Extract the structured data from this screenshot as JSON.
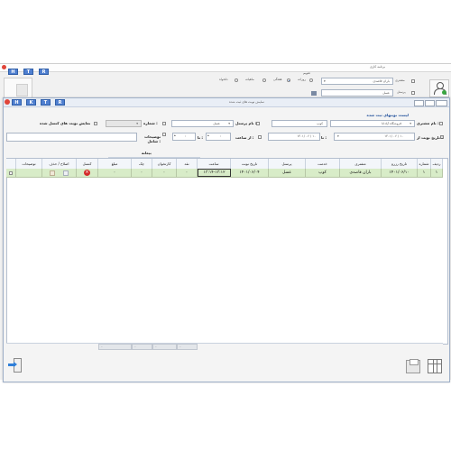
{
  "bg_window": {
    "title": "برنامه کاری",
    "nav_buttons": [
      "H",
      "T",
      "R"
    ],
    "customer_label": "مشتری",
    "customer_value": "باران قاصدی",
    "personnel_label": "پرسنل",
    "personnel_value": "عسل",
    "calendar_label": "تقویم",
    "view_options": [
      {
        "label": "روزانه",
        "selected": false
      },
      {
        "label": "هفتگی",
        "selected": true
      },
      {
        "label": "ماهیانه",
        "selected": false
      },
      {
        "label": "دلخواه",
        "selected": false
      }
    ]
  },
  "dialog": {
    "title": "نمایش نوبت های ثبت شده",
    "nav_buttons": [
      "H",
      "K",
      "T",
      "R"
    ],
    "section_title": "لیست نوبتهای ثبت شده",
    "filters": {
      "customer_label": "نام مشتری :",
      "customer_value": "فروشگاه آپادانا",
      "service_label": "نوع خدمت :",
      "service_value": "کوپ",
      "personnel_label": "نام پرسنل :",
      "personnel_value": "عسل",
      "number_label": "شماره :",
      "show_cancelled_label": "نمایش نوبت های کنسل شده",
      "date_from_label": "تاریخ نوبت از :",
      "date_from_value": "۱۴۰۱/ ۰۶ / ۱۰",
      "date_to_label": "تا :",
      "date_to_value": "۱۴۰۱/ ۰۶ / ۱۰",
      "time_from_label": "از ساعت :",
      "time_from_value": ": ",
      "time_to_label": "تا :",
      "time_to_value": ": ",
      "notes_label": "توضیحات شامل :"
    },
    "table": {
      "group_header": "بیعانه",
      "columns": [
        "ردیف",
        "شماره",
        "تاریخ رزرو",
        "مشتری",
        "خدمت",
        "پرسنل",
        "تاریخ نوبت",
        "ساعت",
        "نقد",
        "کارتخوان",
        "چک",
        "مبلغ",
        "کنسل",
        "اصلاح / حذف",
        "توضیحات"
      ],
      "rows": [
        {
          "row": "۱",
          "number": "۱",
          "reserve_date": "۱۴۰۱/۰۶/۱۰",
          "customer": "باران قاصدی",
          "service": "کوپ",
          "personnel": "عسل",
          "appt_date": "۱۴۰۱/۰۶/۰۴",
          "time": "۱۳:۱۴-۱۳:۱۲",
          "cash": "۰",
          "card": "۰",
          "cheque": "۰",
          "amount": "۰"
        }
      ],
      "footer_totals": [
        "۰",
        "۰",
        "۰",
        "۰"
      ]
    }
  },
  "colors": {
    "accent": "#4f7fd0",
    "row_highlight": "#d8ecc8",
    "cancel_red": "#d42a2a",
    "close_red": "#e0453a"
  }
}
